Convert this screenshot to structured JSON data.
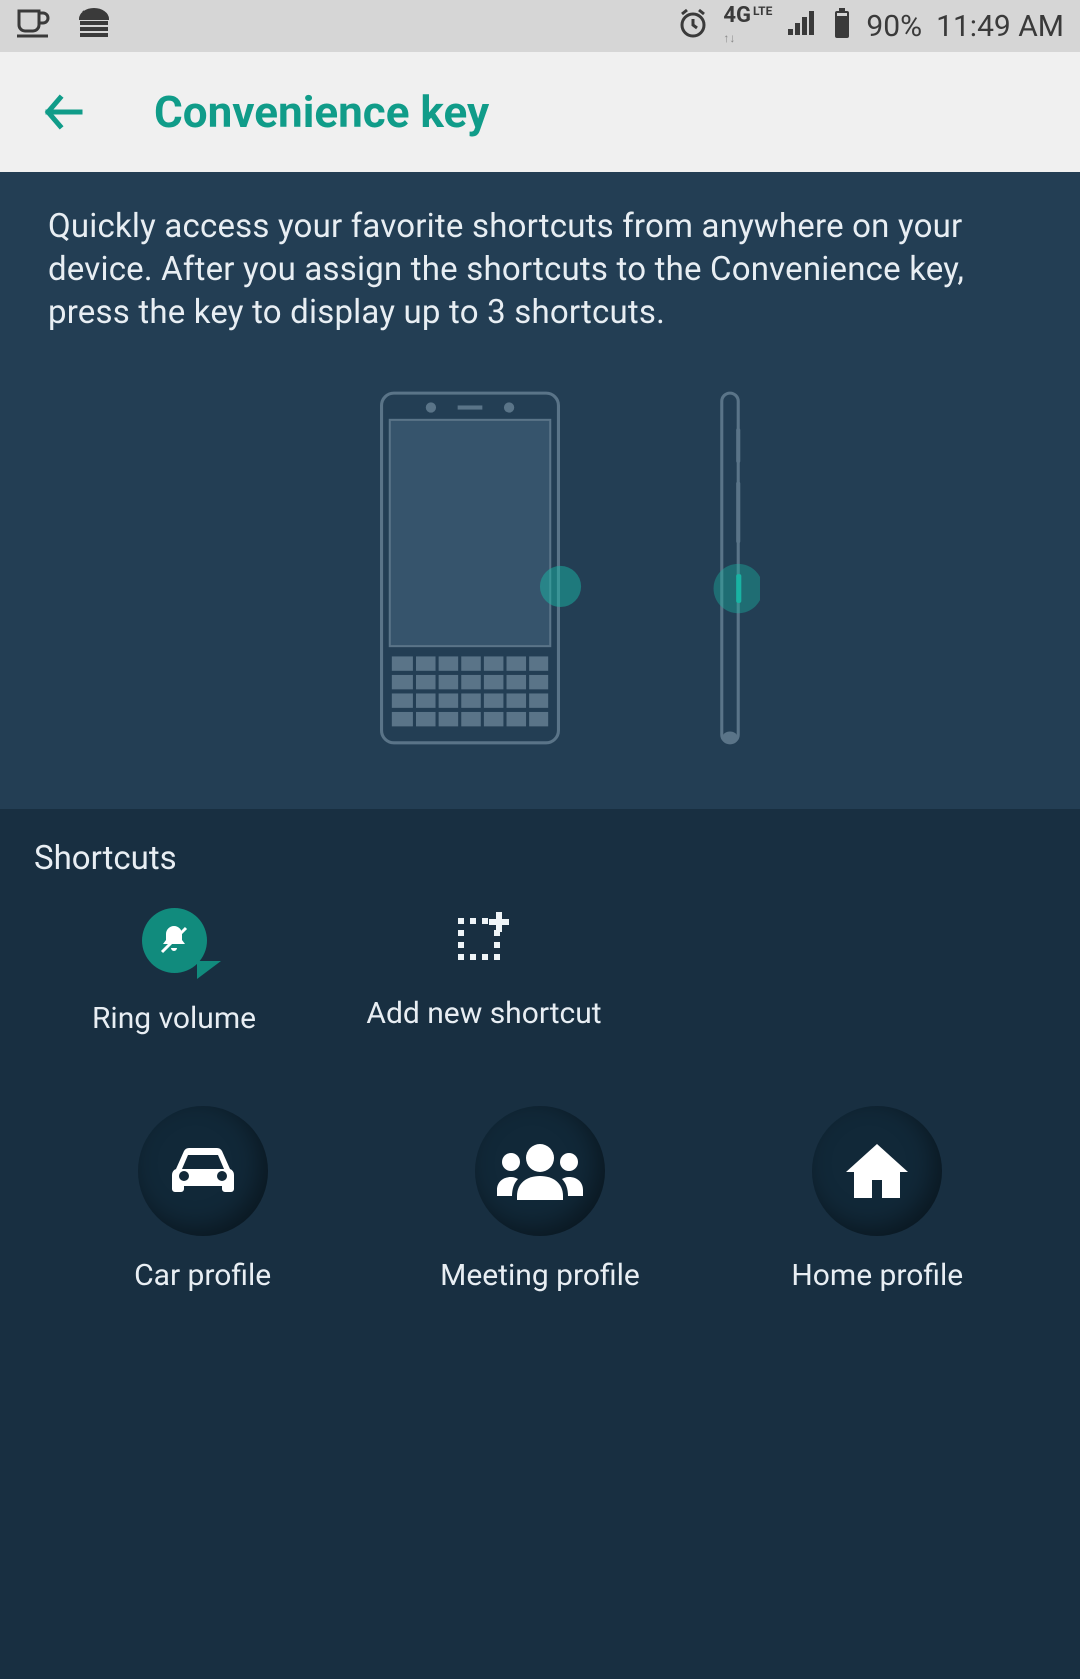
{
  "status": {
    "network": "4G",
    "lte_suffix": "LTE",
    "battery": "90%",
    "time": "11:49 AM"
  },
  "header": {
    "title": "Convenience key"
  },
  "intro": {
    "text": "Quickly access your favorite shortcuts from anywhere on your device. After you assign the shortcuts to the Convenience key, press the key to display up to 3 shortcuts."
  },
  "shortcuts": {
    "section_title": "Shortcuts",
    "row1": [
      {
        "icon": "bell-mute-icon",
        "label": "Ring volume"
      },
      {
        "icon": "add-shortcut-icon",
        "label": "Add new shortcut"
      }
    ],
    "row2": [
      {
        "icon": "car-icon",
        "label": "Car profile"
      },
      {
        "icon": "group-icon",
        "label": "Meeting profile"
      },
      {
        "icon": "home-icon",
        "label": "Home profile"
      }
    ]
  }
}
